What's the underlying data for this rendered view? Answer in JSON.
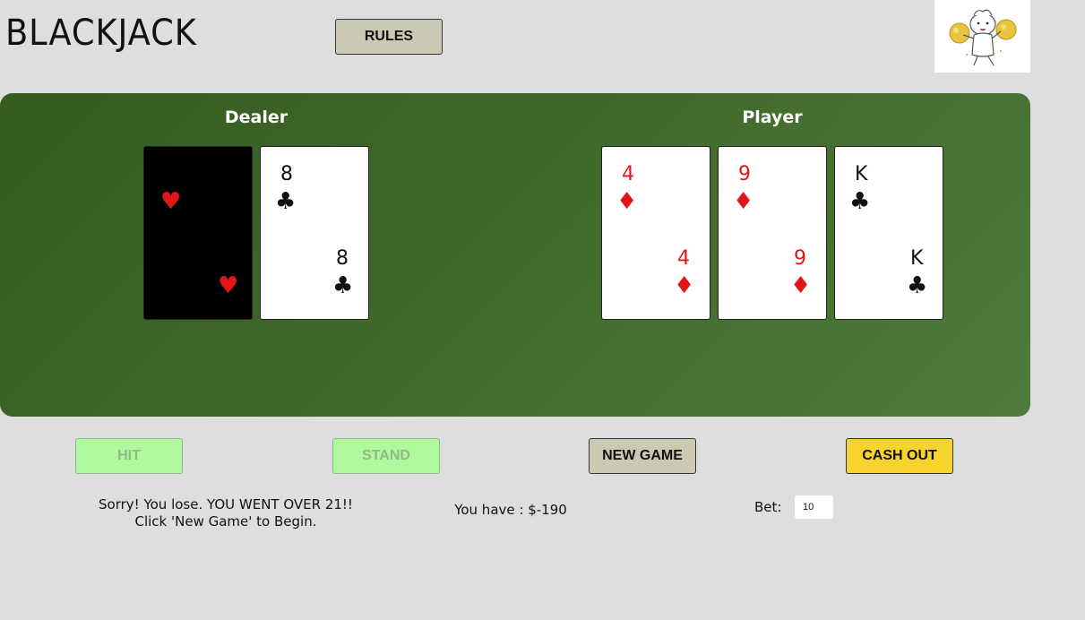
{
  "header": {
    "title": "BLACKJACK",
    "rules_label": "RULES"
  },
  "logo": {
    "icon": "cheerleader-mascot-icon"
  },
  "table": {
    "dealer_label": "Dealer",
    "player_label": "Player",
    "felt_color": "#41682b"
  },
  "dealer_cards": [
    {
      "rank": "",
      "suit": "♥",
      "color": "red",
      "face_down": true
    },
    {
      "rank": "8",
      "suit": "♣",
      "color": "black",
      "face_down": false
    }
  ],
  "player_cards": [
    {
      "rank": "4",
      "suit": "♦",
      "color": "red"
    },
    {
      "rank": "9",
      "suit": "♦",
      "color": "red"
    },
    {
      "rank": "K",
      "suit": "♣",
      "color": "black"
    }
  ],
  "actions": {
    "hit": "HIT",
    "stand": "STAND",
    "new_game": "NEW GAME",
    "cash_out": "CASH OUT"
  },
  "status": {
    "message_line1": "Sorry! You lose. YOU WENT OVER 21!!",
    "message_line2": "Click 'New Game' to Begin.",
    "balance": "You have : $-190",
    "bet_label": "Bet:",
    "bet_value": "10"
  },
  "colors": {
    "hit_stand_bg": "#b1f99f",
    "new_game_bg": "#cbc9b3",
    "cash_out_bg": "#f6d42b"
  }
}
